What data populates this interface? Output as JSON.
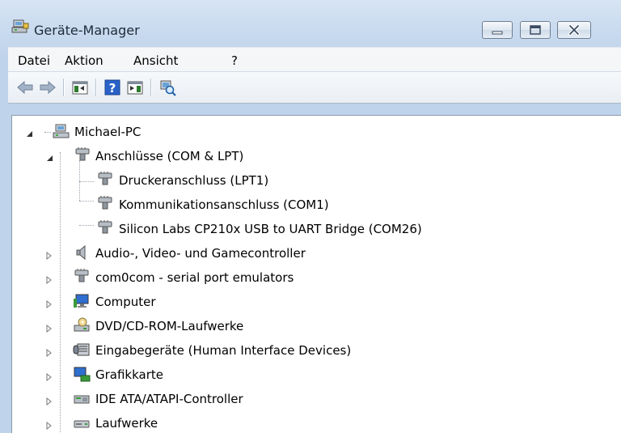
{
  "window": {
    "title": "Geräte-Manager",
    "icons": {
      "app": "device-manager-icon",
      "minimize": "minimize-icon",
      "maximize": "maximize-icon",
      "close": "close-icon"
    }
  },
  "menu": {
    "items": [
      "Datei",
      "Aktion",
      "Ansicht",
      "?"
    ]
  },
  "toolbar": {
    "buttons": [
      "back-arrow-icon",
      "forward-arrow-icon",
      "show-hide-console-tree-icon",
      "help-icon",
      "show-hide-action-pane-icon",
      "scan-hardware-icon"
    ]
  },
  "tree": {
    "root": {
      "label": "Michael-PC",
      "icon": "computer-root-icon",
      "expanded": true
    },
    "nodes": [
      {
        "label": "Anschlüsse (COM & LPT)",
        "icon": "port-connector-icon",
        "expanded": true
      },
      {
        "label": "Druckeranschluss (LPT1)",
        "icon": "port-connector-icon"
      },
      {
        "label": "Kommunikationsanschluss (COM1)",
        "icon": "port-connector-icon"
      },
      {
        "label": "Silicon Labs CP210x USB to UART Bridge (COM26)",
        "icon": "port-connector-icon"
      },
      {
        "label": "Audio-, Video- und Gamecontroller",
        "icon": "speaker-icon",
        "expanded": false
      },
      {
        "label": "com0com - serial port emulators",
        "icon": "port-connector-icon",
        "expanded": false
      },
      {
        "label": "Computer",
        "icon": "computer-icon",
        "expanded": false
      },
      {
        "label": "DVD/CD-ROM-Laufwerke",
        "icon": "dvd-drive-icon",
        "expanded": false
      },
      {
        "label": "Eingabegeräte (Human Interface Devices)",
        "icon": "hid-icon",
        "expanded": false
      },
      {
        "label": "Grafikkarte",
        "icon": "display-adapter-icon",
        "expanded": false
      },
      {
        "label": "IDE ATA/ATAPI-Controller",
        "icon": "ide-controller-icon",
        "expanded": false
      },
      {
        "label": "Laufwerke",
        "icon": "disk-drive-icon",
        "expanded": false
      }
    ]
  }
}
